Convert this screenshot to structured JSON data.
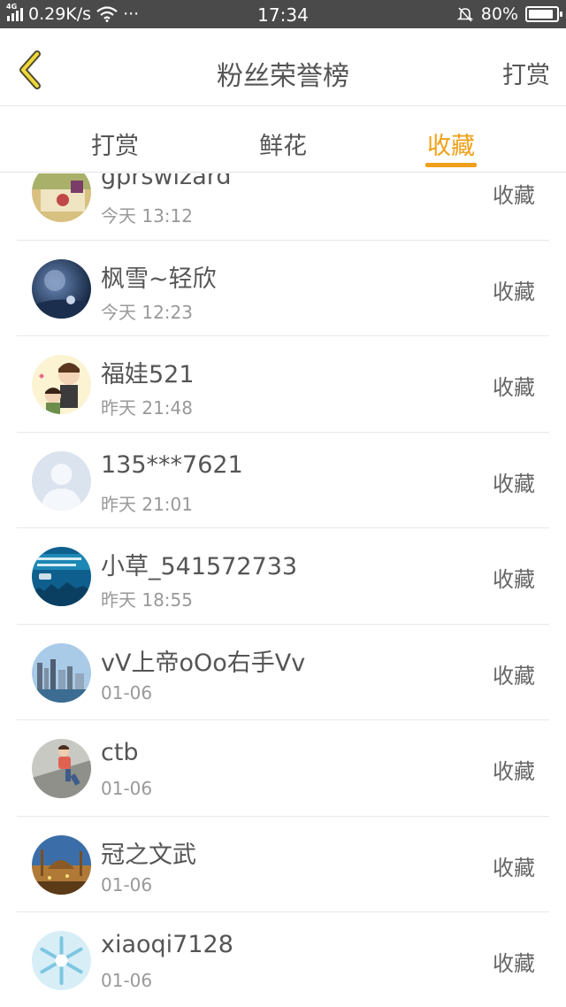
{
  "status_bar": {
    "network": "4G",
    "speed": "0.29K/s",
    "more": "···",
    "time": "17:34",
    "battery": "80%"
  },
  "nav": {
    "title": "粉丝荣誉榜",
    "action": "打赏"
  },
  "tabs": [
    {
      "label": "打赏",
      "active": false
    },
    {
      "label": "鲜花",
      "active": false
    },
    {
      "label": "收藏",
      "active": true
    }
  ],
  "accent_color": "#f0a018",
  "list": [
    {
      "name": "gprswizard",
      "time": "今天 13:12",
      "action": "收藏",
      "avatar": "photo-avatar"
    },
    {
      "name": "枫雪~轻欣",
      "time": "今天 12:23",
      "action": "收藏",
      "avatar": "night-sky-avatar"
    },
    {
      "name": "福娃521",
      "time": "昨天 21:48",
      "action": "收藏",
      "avatar": "cartoon-avatar"
    },
    {
      "name": "135***7621",
      "time": "昨天 21:01",
      "action": "收藏",
      "avatar": "default-avatar"
    },
    {
      "name": "小草_541572733",
      "time": "昨天 18:55",
      "action": "收藏",
      "avatar": "ad-avatar"
    },
    {
      "name": "vV上帝oOo右手Vv",
      "time": "01-06",
      "action": "收藏",
      "avatar": "city-avatar"
    },
    {
      "name": "ctb",
      "time": "01-06",
      "action": "收藏",
      "avatar": "child-avatar"
    },
    {
      "name": "冠之文武",
      "time": "01-06",
      "action": "收藏",
      "avatar": "mosque-avatar"
    },
    {
      "name": "xiaoqi7128",
      "time": "01-06",
      "action": "收藏",
      "avatar": "snowflake-avatar"
    }
  ]
}
